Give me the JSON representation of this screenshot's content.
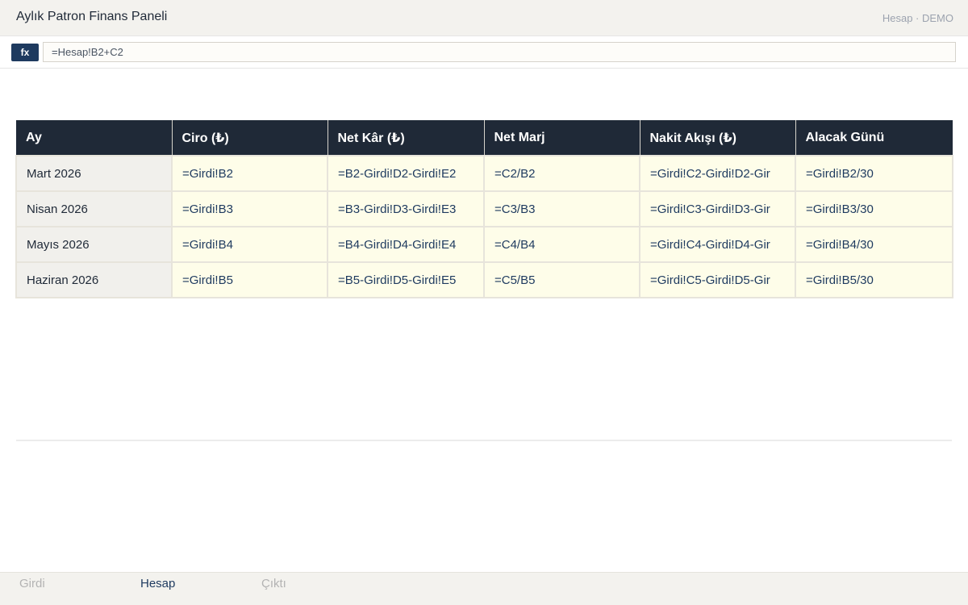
{
  "app": {
    "title": "Aylık Patron Finans Paneli",
    "status": "Hesap · DEMO"
  },
  "formula_bar": {
    "fx_label": "fx",
    "value": "=Hesap!B2+C2"
  },
  "table": {
    "headers": [
      "Ay",
      "Ciro (₺)",
      "Net Kâr (₺)",
      "Net Marj",
      "Nakit Akışı (₺)",
      "Alacak Günü"
    ],
    "rows": [
      [
        "Mart 2026",
        "=Girdi!B2",
        "=B2-Girdi!D2-Girdi!E2",
        "=C2/B2",
        "=Girdi!C2-Girdi!D2-Gir",
        "=Girdi!B2/30"
      ],
      [
        "Nisan 2026",
        "=Girdi!B3",
        "=B3-Girdi!D3-Girdi!E3",
        "=C3/B3",
        "=Girdi!C3-Girdi!D3-Gir",
        "=Girdi!B3/30"
      ],
      [
        "Mayıs 2026",
        "=Girdi!B4",
        "=B4-Girdi!D4-Girdi!E4",
        "=C4/B4",
        "=Girdi!C4-Girdi!D4-Gir",
        "=Girdi!B4/30"
      ],
      [
        "Haziran 2026",
        "=Girdi!B5",
        "=B5-Girdi!D5-Girdi!E5",
        "=C5/B5",
        "=Girdi!C5-Girdi!D5-Gir",
        "=Girdi!B5/30"
      ]
    ]
  },
  "tabs": [
    {
      "label": "Girdi",
      "active": false
    },
    {
      "label": "Hesap",
      "active": true
    },
    {
      "label": "Çıktı",
      "active": false
    }
  ],
  "colors": {
    "header_bg": "#1f2937",
    "accent": "#1e3a5f",
    "formula_cell_bg": "#fefde9",
    "label_cell_bg": "#f1f0ec"
  }
}
